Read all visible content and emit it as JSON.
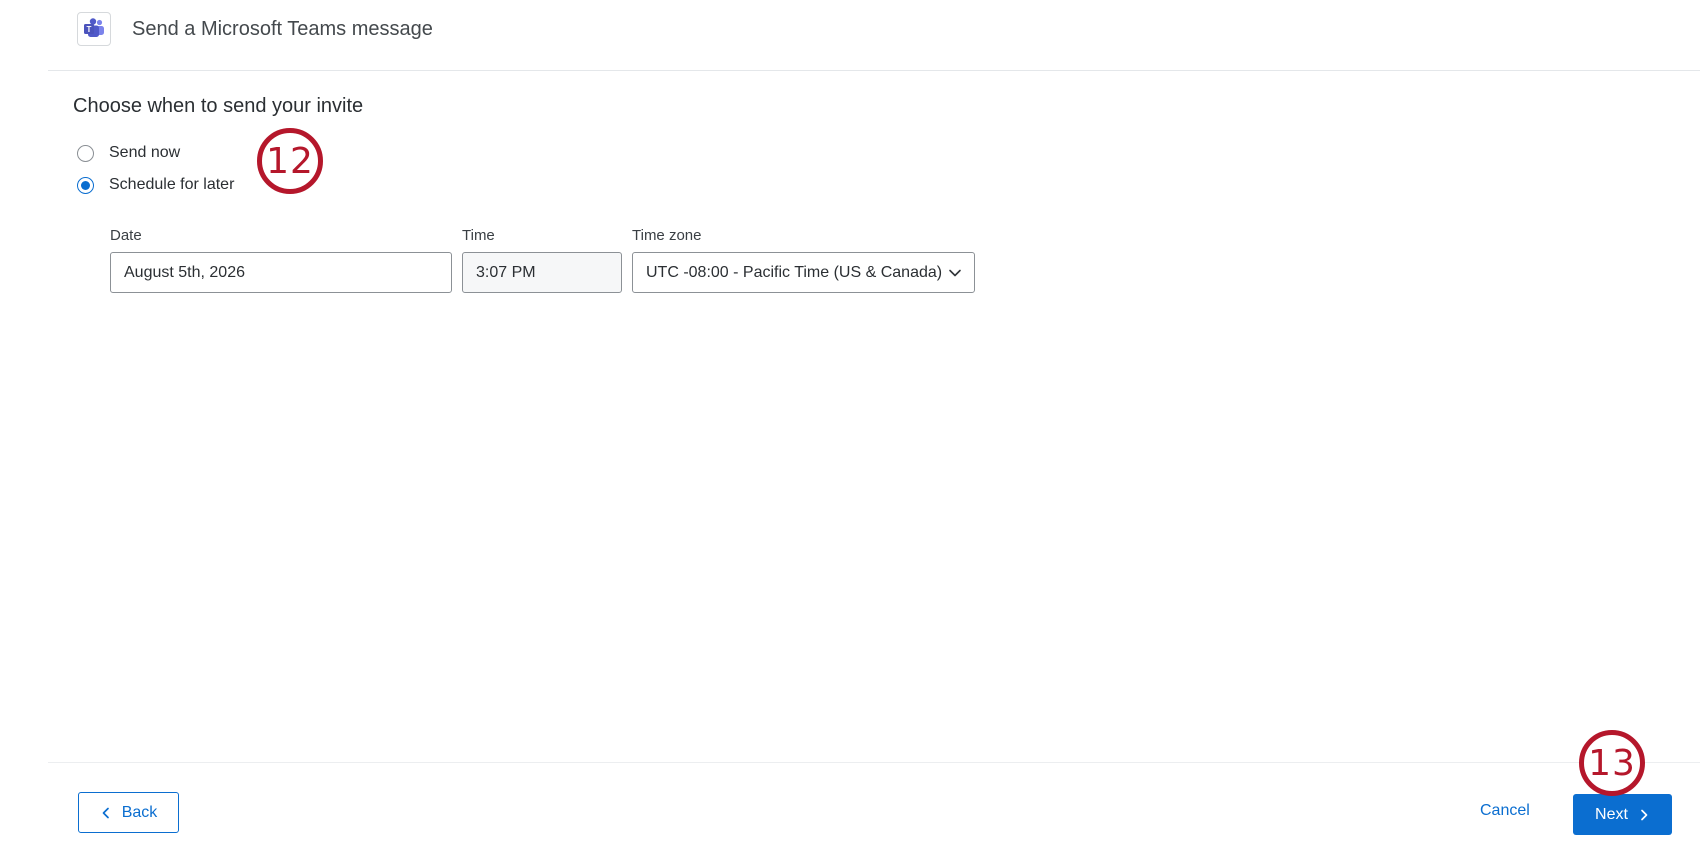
{
  "header": {
    "app_icon": "microsoft-teams-icon",
    "title": "Send a Microsoft Teams message"
  },
  "schedule": {
    "heading": "Choose when to send your invite",
    "options": [
      {
        "label": "Send now",
        "selected": false
      },
      {
        "label": "Schedule for later",
        "selected": true
      }
    ]
  },
  "fields": {
    "date": {
      "label": "Date",
      "value": "August 5th, 2026"
    },
    "time": {
      "label": "Time",
      "value": "3:07 PM"
    },
    "timezone": {
      "label": "Time zone",
      "value": "UTC -08:00 - Pacific Time (US & Canada)"
    }
  },
  "footer": {
    "back_label": "Back",
    "cancel_label": "Cancel",
    "next_label": "Next"
  },
  "annotations": {
    "step_a": "12",
    "step_b": "13"
  },
  "colors": {
    "accent": "#0b6ed0",
    "annotation": "#b5172b",
    "teams_brand": "#5059c9"
  }
}
